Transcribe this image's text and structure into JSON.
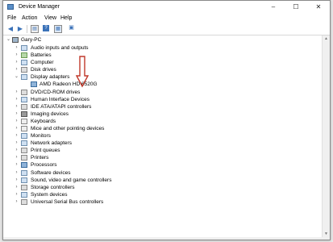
{
  "window": {
    "title": "Device Manager",
    "controls": {
      "minimize": "–",
      "maximize": "☐",
      "close": "✕"
    }
  },
  "menu": [
    "File",
    "Action",
    "View",
    "Help"
  ],
  "toolbar": [
    "back",
    "forward",
    "properties",
    "help",
    "scan"
  ],
  "tree": {
    "root": "Gary-PC",
    "items": [
      {
        "label": "Audio inputs and outputs",
        "expanded": false
      },
      {
        "label": "Batteries",
        "expanded": false
      },
      {
        "label": "Computer",
        "expanded": false
      },
      {
        "label": "Disk drives",
        "expanded": false
      },
      {
        "label": "Display adapters",
        "expanded": true,
        "children": [
          "AMD Radeon HD 6520G"
        ]
      },
      {
        "label": "DVD/CD-ROM drives",
        "expanded": false
      },
      {
        "label": "Human Interface Devices",
        "expanded": false
      },
      {
        "label": "IDE ATA/ATAPI controllers",
        "expanded": false
      },
      {
        "label": "Imaging devices",
        "expanded": false
      },
      {
        "label": "Keyboards",
        "expanded": false
      },
      {
        "label": "Mice and other pointing devices",
        "expanded": false
      },
      {
        "label": "Monitors",
        "expanded": false
      },
      {
        "label": "Network adapters",
        "expanded": false
      },
      {
        "label": "Print queues",
        "expanded": false
      },
      {
        "label": "Printers",
        "expanded": false
      },
      {
        "label": "Processors",
        "expanded": false
      },
      {
        "label": "Software devices",
        "expanded": false
      },
      {
        "label": "Sound, video and game controllers",
        "expanded": false
      },
      {
        "label": "Storage controllers",
        "expanded": false
      },
      {
        "label": "System devices",
        "expanded": false
      },
      {
        "label": "Universal Serial Bus controllers",
        "expanded": false
      }
    ]
  },
  "colors": {
    "accent": "#3b72b8",
    "annotation_arrow": "#c0392b"
  }
}
